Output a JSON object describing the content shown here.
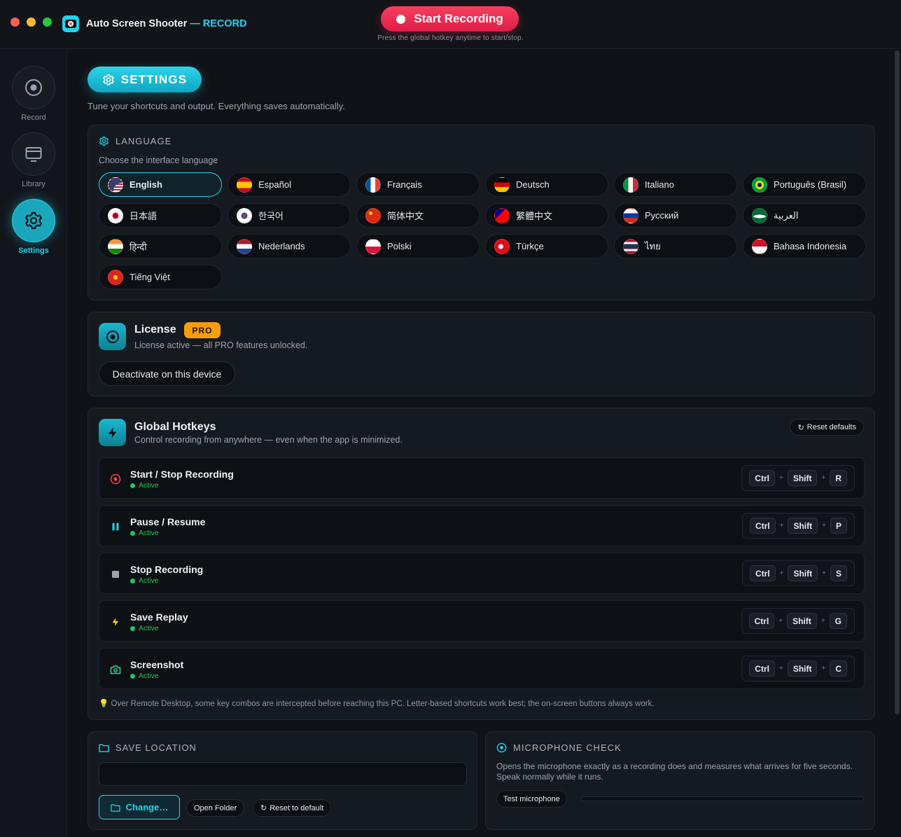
{
  "window": {
    "title": "Auto Screen Shooter",
    "title_accent": "— RECORD"
  },
  "header": {
    "record_button": "Start Recording",
    "hotkey_hint": "Press the global hotkey anytime to start/stop."
  },
  "sidebar": {
    "items": [
      {
        "label": "Record",
        "icon": "record-icon"
      },
      {
        "label": "Library",
        "icon": "monitor-icon"
      },
      {
        "label": "Settings",
        "icon": "gear-icon",
        "active": true
      }
    ]
  },
  "page": {
    "title": "SETTINGS",
    "subtitle": "Tune your shortcuts and output. Everything saves automatically."
  },
  "language": {
    "heading": "LANGUAGE",
    "hint": "Choose the interface language",
    "selected": "English",
    "options": [
      "English",
      "Español",
      "Français",
      "Deutsch",
      "Italiano",
      "Português (Brasil)",
      "日本語",
      "한국어",
      "简体中文",
      "繁體中文",
      "Русский",
      "العربية",
      "हिन्दी",
      "Nederlands",
      "Polski",
      "Türkçe",
      "ไทย",
      "Bahasa Indonesia",
      "Tiếng Việt"
    ]
  },
  "license": {
    "title": "License",
    "badge": "PRO",
    "status": "License active — all PRO features unlocked.",
    "deactivate": "Deactivate on this device"
  },
  "hotkeys": {
    "title": "Global Hotkeys",
    "subtitle": "Control recording from anywhere — even when the app is minimized.",
    "reset": "Reset defaults",
    "rows": [
      {
        "name": "Start / Stop Recording",
        "status": "Active",
        "keys": [
          "Ctrl",
          "Shift",
          "R"
        ],
        "icon_color": "#ef4444"
      },
      {
        "name": "Pause / Resume",
        "status": "Active",
        "keys": [
          "Ctrl",
          "Shift",
          "P"
        ],
        "icon_color": "#22d3ee"
      },
      {
        "name": "Stop Recording",
        "status": "Active",
        "keys": [
          "Ctrl",
          "Shift",
          "S"
        ],
        "icon_color": "#9aa3ae"
      },
      {
        "name": "Save Replay",
        "status": "Active",
        "keys": [
          "Ctrl",
          "Shift",
          "G"
        ],
        "icon_color": "#facc15"
      },
      {
        "name": "Screenshot",
        "status": "Active",
        "keys": [
          "Ctrl",
          "Shift",
          "C"
        ],
        "icon_color": "#34d399"
      }
    ],
    "note": "Over Remote Desktop, some key combos are intercepted before reaching this PC. Letter-based shortcuts work best; the on-screen buttons always work."
  },
  "save_location": {
    "heading": "SAVE LOCATION",
    "path": "",
    "change": "Change…",
    "open_folder": "Open Folder",
    "reset": "Reset to default"
  },
  "microphone": {
    "heading": "MICROPHONE CHECK",
    "description": "Opens the microphone exactly as a recording does and measures what arrives for five seconds. Speak normally while it runs.",
    "test": "Test microphone",
    "level": 0
  },
  "colors": {
    "accent": "#22d3ee",
    "record": "#e11d48",
    "pro": "#f59e0b",
    "active": "#22c55e"
  }
}
